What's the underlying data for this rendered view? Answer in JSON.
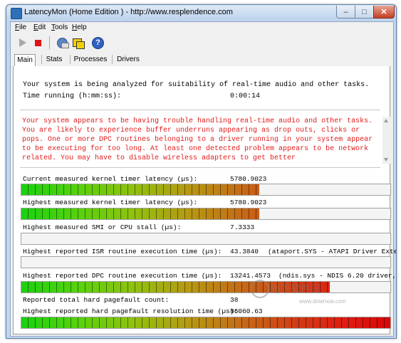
{
  "window": {
    "title": "LatencyMon  (Home Edition )  -  http://www.resplendence.com",
    "minimize": "–",
    "maximize": "□",
    "close": "✕"
  },
  "menu": [
    {
      "mnemonic": "F",
      "rest": "ile"
    },
    {
      "mnemonic": "E",
      "rest": "dit"
    },
    {
      "mnemonic": "T",
      "rest": "ools"
    },
    {
      "mnemonic": "H",
      "rest": "elp"
    }
  ],
  "toolbar": {
    "icons": [
      "play-icon",
      "stop-icon",
      "drivers-icon",
      "windows-icon",
      "help-icon"
    ]
  },
  "tabs": [
    {
      "label": "Main",
      "active": true
    },
    {
      "label": "Stats",
      "active": false
    },
    {
      "label": "Processes",
      "active": false
    },
    {
      "label": "Drivers",
      "active": false
    }
  ],
  "status": {
    "analyzing": "Your system is being analyzed for suitability of real-time audio and other tasks.",
    "time_running_label": "Time running (h:mm:ss):",
    "time_running_value": "0:00:14"
  },
  "warning": {
    "text": "Your system appears to be having trouble handling real-time audio and other tasks. You are likely to experience buffer underruns appearing as drop outs, clicks or pops. One or more DPC routines belonging to a driver running in your system appear to be executing for too long. At least one detected problem appears to be network related. You may have to disable wireless adapters to get better",
    "color": "#e11b1b"
  },
  "metrics": {
    "current_timer": {
      "label": "Current measured kernel timer latency (µs):",
      "value": "5780.9023",
      "bar_fraction": 0.645
    },
    "highest_timer": {
      "label": "Highest measured kernel timer latency (µs):",
      "value": "5780.9023",
      "bar_fraction": 0.645
    },
    "smi_stall": {
      "label": "Highest measured SMI or CPU stall (µs):",
      "value": "7.3333",
      "bar_fraction": 0
    },
    "isr": {
      "label": "Highest reported ISR routine execution time (µs):",
      "value": "43.3840",
      "detail": "(ataport.SYS - ATAPI Driver Exter",
      "bar_fraction": 0
    },
    "dpc": {
      "label": "Highest reported DPC routine execution time (µs):",
      "value": "13241.4573",
      "detail": "(ndis.sys - NDIS 6.20 driver,",
      "bar_fraction": 0.835
    },
    "pagefault_count": {
      "label": "Reported total hard pagefault count:",
      "value": "38"
    },
    "pagefault_resolution": {
      "label": "Highest reported hard pagefault resolution time (µs):",
      "value": "86060.63",
      "bar_fraction": 1.0
    }
  },
  "watermark": {
    "main": "当下软件园",
    "sub": "www.downxia.com"
  }
}
